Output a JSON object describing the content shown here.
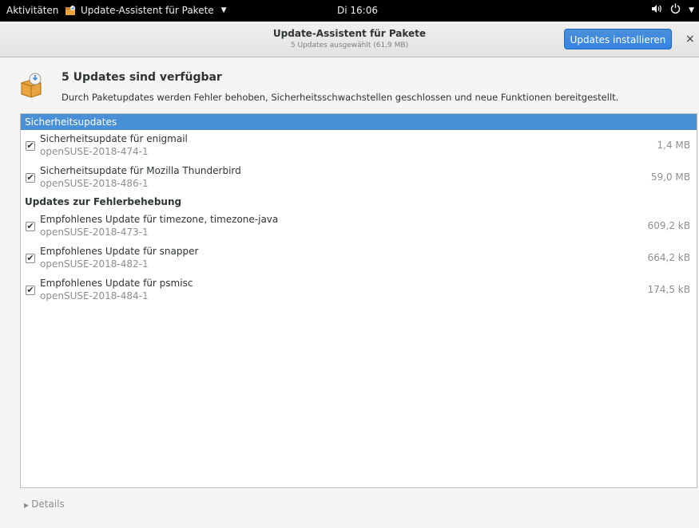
{
  "topbar": {
    "activities": "Aktivitäten",
    "app_name": "Update-Assistent für Pakete",
    "clock": "Di 16:06",
    "icons": [
      "volume-icon",
      "power-icon",
      "chevron-down-icon"
    ]
  },
  "header": {
    "title": "Update-Assistent für Pakete",
    "subtitle": "5 Updates ausgewählt (61,9 MB)",
    "install_label": "Updates installieren",
    "close_label": "×"
  },
  "info": {
    "title": "5 Updates sind verfügbar",
    "description": "Durch Paketupdates werden Fehler behoben, Sicherheitsschwachstellen geschlossen und neue Funktionen bereitgestellt."
  },
  "categories": [
    {
      "label": "Sicherheitsupdates",
      "items": [
        {
          "name": "Sicherheitsupdate für enigmail",
          "package": "openSUSE-2018-474-1",
          "size": "1,4 MB",
          "checked": true
        },
        {
          "name": "Sicherheitsupdate für Mozilla Thunderbird",
          "package": "openSUSE-2018-486-1",
          "size": "59,0 MB",
          "checked": true
        }
      ]
    },
    {
      "label": "Updates zur Fehlerbehebung",
      "items": [
        {
          "name": "Empfohlenes Update für timezone, timezone-java",
          "package": "openSUSE-2018-473-1",
          "size": "609,2 kB",
          "checked": true
        },
        {
          "name": "Empfohlenes Update für snapper",
          "package": "openSUSE-2018-482-1",
          "size": "664,2 kB",
          "checked": true
        },
        {
          "name": "Empfohlenes Update für psmisc",
          "package": "openSUSE-2018-484-1",
          "size": "174,5 kB",
          "checked": true
        }
      ]
    }
  ],
  "checkmark": "✔",
  "details_label": "Details",
  "colors": {
    "accent": "#4a90d9",
    "topbar": "#000000",
    "muted_text": "#8b8f90"
  }
}
